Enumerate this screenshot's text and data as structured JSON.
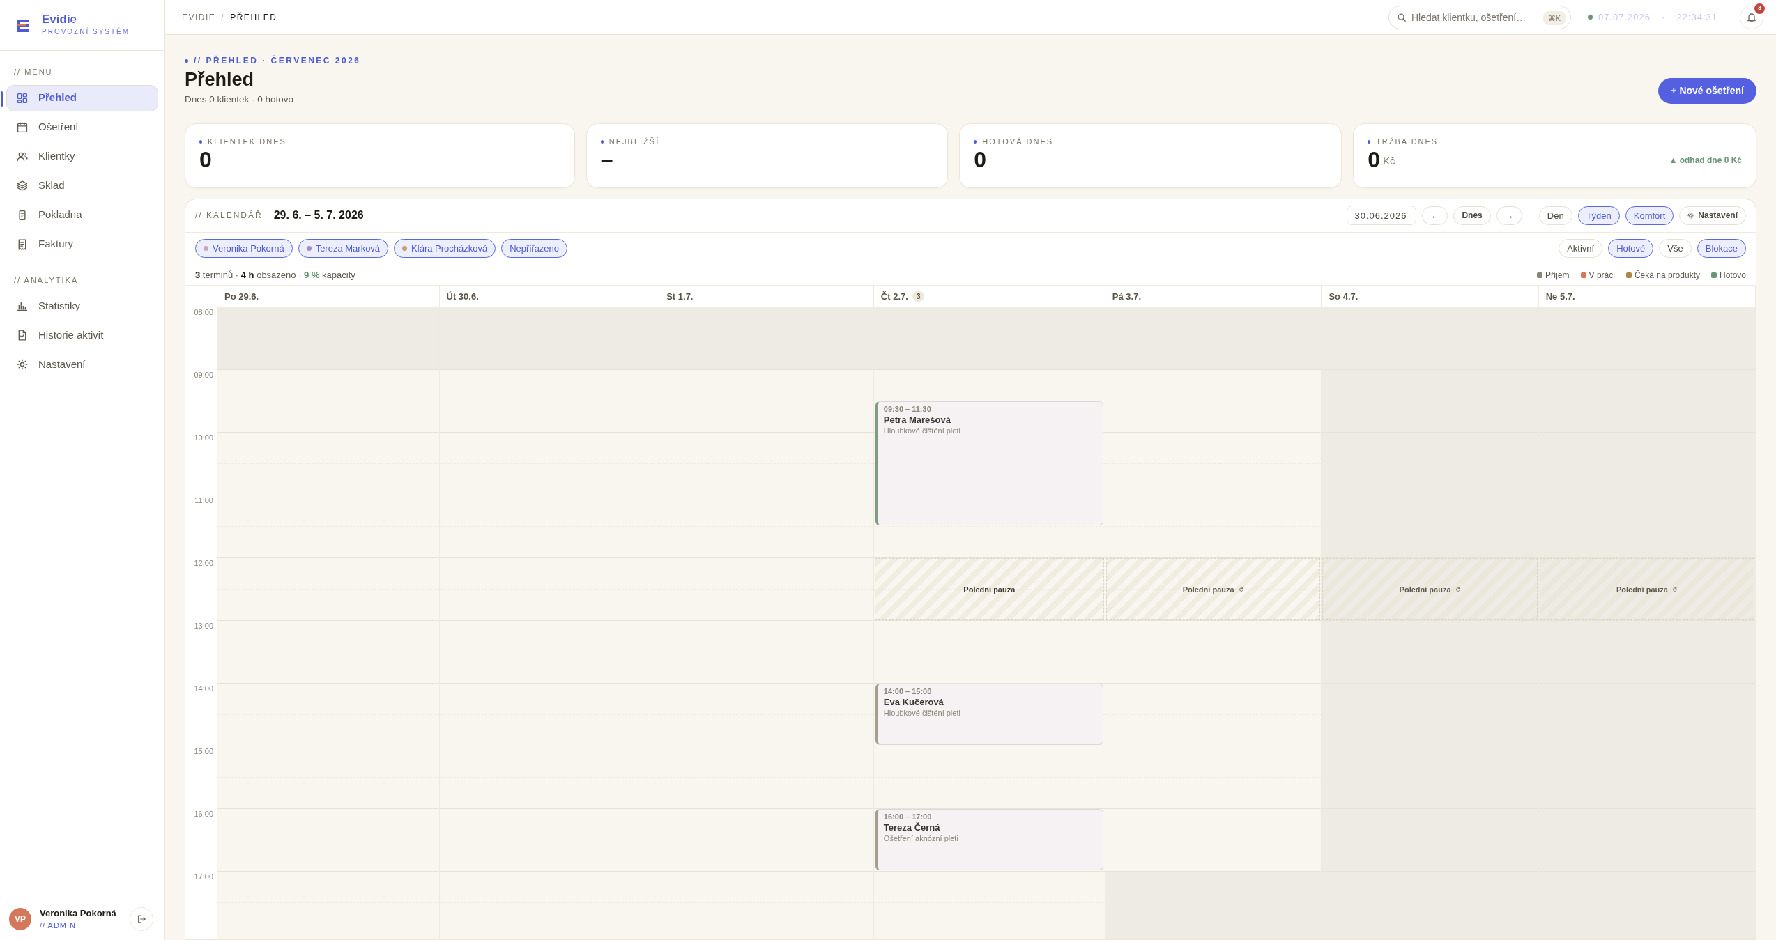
{
  "sidebar": {
    "brand": {
      "name": "Evidie",
      "tagline": "PROVOZNÍ SYSTÉM"
    },
    "sections": [
      {
        "heading": "// MENU",
        "items": [
          {
            "label": "Přehled",
            "selected": true
          },
          {
            "label": "Ošetření",
            "selected": false
          },
          {
            "label": "Klientky",
            "selected": false
          },
          {
            "label": "Sklad",
            "selected": false
          },
          {
            "label": "Pokladna",
            "selected": false
          },
          {
            "label": "Faktury",
            "selected": false
          }
        ]
      },
      {
        "heading": "// ANALYTIKA",
        "items": [
          {
            "label": "Statistiky",
            "selected": false
          },
          {
            "label": "Historie aktivit",
            "selected": false
          },
          {
            "label": "Nastavení",
            "selected": false
          }
        ]
      }
    ],
    "user": {
      "initials": "VP",
      "name": "Veronika Pokorná",
      "role": "// ADMIN"
    }
  },
  "header": {
    "breadcrumb": [
      "EVIDIE",
      "PŘEHLED"
    ],
    "separator": "/",
    "search": {
      "placeholder": "Hledat klientku, ošetření…",
      "shortcut": "⌘K"
    },
    "status": {
      "online": true,
      "date": "07.07.2026",
      "separator": "·",
      "time": "22:34:31"
    },
    "notifications": "3"
  },
  "page": {
    "eyebrow": "// PŘEHLED · ČERVENEC 2026",
    "title": "Přehled",
    "subtitle": "Dnes 0 klientek · 0 hotovo",
    "new_button": "+ Nové ošetření"
  },
  "stats": [
    {
      "label": "KLIENTEK DNES",
      "value": "0"
    },
    {
      "label": "NEJBLIŽŠÍ",
      "value": "–"
    },
    {
      "label": "HOTOVÁ DNES",
      "value": "0"
    },
    {
      "label": "TRŽBA DNES",
      "value": "0",
      "unit": "Kč",
      "trend": "▲ odhad dne 0 Kč"
    }
  ],
  "calendar": {
    "eyebrow": "// KALENDÁŘ",
    "range": "29. 6. – 5. 7. 2026",
    "date": "30.06.2026",
    "prev": "←",
    "today": "Dnes",
    "next": "→",
    "views": [
      {
        "label": "Den",
        "selected": false
      },
      {
        "label": "Týden",
        "selected": true
      },
      {
        "label": "Komfort",
        "selected": true
      }
    ],
    "settings": "Nastavení",
    "staff": [
      {
        "name": "Veronika Pokorná",
        "color": "#c9a6b8",
        "selected": true
      },
      {
        "name": "Tereza Marková",
        "color": "#a58bc7",
        "selected": true
      },
      {
        "name": "Klára Procházková",
        "color": "#c99e6c",
        "selected": true
      },
      {
        "name": "Nepřiřazeno",
        "selected": true
      }
    ],
    "filters": [
      {
        "label": "Aktivní",
        "selected": false
      },
      {
        "label": "Hotové",
        "selected": true
      },
      {
        "label": "Vše",
        "selected": false
      },
      {
        "label": "Blokace",
        "selected": true
      }
    ],
    "summary": [
      {
        "text": "3",
        "kind": "strong"
      },
      {
        "text": " terminů · ",
        "kind": "plain"
      },
      {
        "text": "4 h",
        "kind": "strong"
      },
      {
        "text": " obsazeno · ",
        "kind": "plain"
      },
      {
        "text": "9 %",
        "kind": "good"
      },
      {
        "text": " kapacity",
        "kind": "plain"
      }
    ],
    "legend": [
      {
        "label": "Příjem",
        "color": "#8a8376"
      },
      {
        "label": "V práci",
        "color": "#dc7658"
      },
      {
        "label": "Čeká na produkty",
        "color": "#ad8643"
      },
      {
        "label": "Hotovo",
        "color": "#6c9574"
      }
    ],
    "hours": [
      "08:00",
      "09:00",
      "10:00",
      "11:00",
      "12:00",
      "13:00",
      "14:00",
      "15:00",
      "16:00",
      "17:00"
    ],
    "days": [
      {
        "label": "Po 29.6.",
        "kind": "workday"
      },
      {
        "label": "Út 30.6.",
        "kind": "workday"
      },
      {
        "label": "St 1.7.",
        "kind": "workday"
      },
      {
        "label": "Čt 2.7.",
        "count": "3",
        "kind": "workday",
        "pause": {
          "label": "Polední pauza",
          "recurring": false
        },
        "events": [
          {
            "time": "09:30 – 11:30",
            "name": "Petra Marešová",
            "service": "Hloubkové čištění pleti",
            "color": "#7f9c80"
          },
          {
            "time": "14:00 – 15:00",
            "name": "Eva Kučerová",
            "service": "Hloubkové čištění pleti",
            "color": "#a49e92"
          },
          {
            "time": "16:00 – 17:00",
            "name": "Tereza Černá",
            "service": "Ošetření aknózní pleti",
            "color": "#a49e92"
          }
        ]
      },
      {
        "label": "Pá 3.7.",
        "kind": "short",
        "pause": {
          "label": "Polední pauza",
          "recurring": true
        }
      },
      {
        "label": "So 4.7.",
        "kind": "weekend",
        "pause": {
          "label": "Polední pauza",
          "recurring": true
        }
      },
      {
        "label": "Ne 5.7.",
        "kind": "weekend",
        "pause": {
          "label": "Polední pauza",
          "recurring": true
        }
      }
    ]
  }
}
